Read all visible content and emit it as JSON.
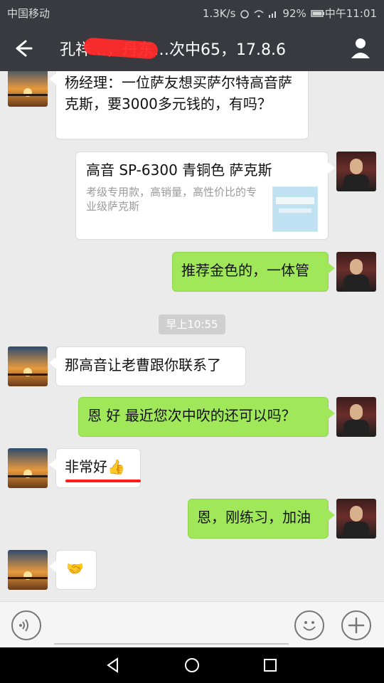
{
  "status": {
    "carrier": "中国移动",
    "speed": "1.3K/s",
    "battery": "92%",
    "time": "中午11:01"
  },
  "header": {
    "title": "孔祥…，丹东…次中65，17.8.6"
  },
  "messages": [
    {
      "side": "left",
      "text": "杨经理：一位萨友想买萨尔特高音萨克斯，要3000多元钱的，有吗？"
    },
    {
      "side": "right",
      "card": {
        "title": "高音 SP-6300 青铜色 萨克斯",
        "desc": "考级专用款，高销量，高性价比的专业级萨克斯"
      }
    },
    {
      "side": "right",
      "text": "推荐金色的，一体管"
    },
    {
      "type": "time",
      "text": "早上10:55"
    },
    {
      "side": "left",
      "text": "那高音让老曹跟你联系了"
    },
    {
      "side": "right",
      "text": "恩  好  最近您次中吹的还可以吗？"
    },
    {
      "side": "left",
      "text": "非常好👍"
    },
    {
      "side": "right",
      "text": "恩，刚练习，加油"
    },
    {
      "side": "left",
      "text": "🤝"
    }
  ],
  "icons": {
    "back": "arrow-left-icon",
    "profile": "user-icon",
    "voice": "voice-icon",
    "emoji": "smile-icon",
    "more": "plus-icon"
  },
  "colors": {
    "green_bubble": "#a0e75a",
    "title_bg": "#393a3f",
    "chat_bg": "#ebebeb"
  }
}
